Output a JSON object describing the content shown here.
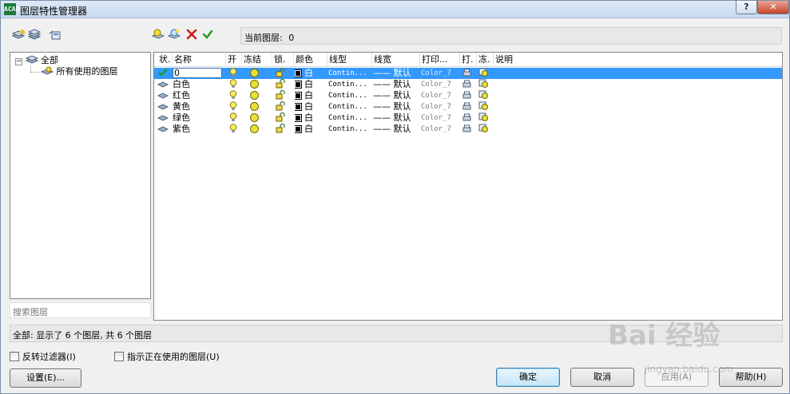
{
  "window": {
    "title": "图层特性管理器",
    "app_icon_text": "AutoCAD",
    "help_button": "?",
    "close_button": "✕"
  },
  "current_layer": {
    "label": "当前图层:",
    "value": "0"
  },
  "tree": {
    "root": "全部",
    "child": "所有使用的图层"
  },
  "search": {
    "placeholder": "搜索图层"
  },
  "grid": {
    "headers": [
      "状.",
      "名称",
      "开",
      "冻结",
      "锁.",
      "颜色",
      "线型",
      "线宽",
      "打印...",
      "打.",
      "冻.",
      "说明"
    ],
    "rows": [
      {
        "name": "0",
        "color": "白",
        "linetype": "Contin...",
        "lineweight": "—— 默认",
        "plotstyle": "Color_7",
        "current": true
      },
      {
        "name": "白色",
        "color": "白",
        "linetype": "Contin...",
        "lineweight": "—— 默认",
        "plotstyle": "Color_7",
        "current": false
      },
      {
        "name": "红色",
        "color": "白",
        "linetype": "Contin...",
        "lineweight": "—— 默认",
        "plotstyle": "Color_7",
        "current": false
      },
      {
        "name": "黄色",
        "color": "白",
        "linetype": "Contin...",
        "lineweight": "—— 默认",
        "plotstyle": "Color_7",
        "current": false
      },
      {
        "name": "绿色",
        "color": "白",
        "linetype": "Contin...",
        "lineweight": "—— 默认",
        "plotstyle": "Color_7",
        "current": false
      },
      {
        "name": "紫色",
        "color": "白",
        "linetype": "Contin...",
        "lineweight": "—— 默认",
        "plotstyle": "Color_7",
        "current": false
      }
    ]
  },
  "status": {
    "text": "全部: 显示了 6 个图层, 共 6 个图层"
  },
  "options": {
    "invert_filter": "反转过滤器(I)",
    "indicate_in_use": "指示正在使用的图层(U)"
  },
  "buttons": {
    "settings": "设置(E)...",
    "ok": "确定",
    "cancel": "取消",
    "apply": "应用(A)",
    "help": "帮助(H)"
  },
  "watermark": {
    "brand": "Bai 经验",
    "url": "jingyan.baidu.com"
  },
  "colors": {
    "accent": "#3399ff",
    "bulb": "#e8e03a",
    "check": "#1a9c1a",
    "delete": "#cc1a1a"
  }
}
